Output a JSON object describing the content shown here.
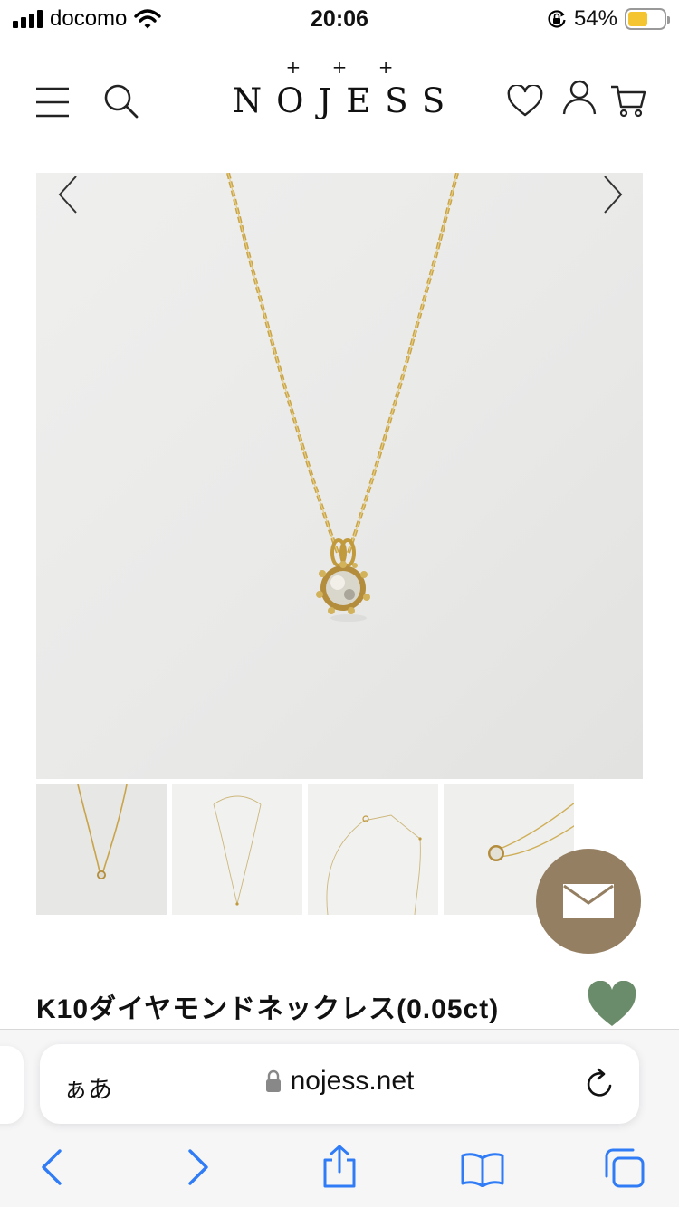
{
  "status_bar": {
    "carrier": "docomo",
    "time": "20:06",
    "battery_percent": "54%",
    "battery_level": 0.54,
    "icons": [
      "signal-icon",
      "wifi-icon",
      "orientation-lock-icon",
      "battery-icon"
    ]
  },
  "header": {
    "brand_ornament": "+ + +",
    "brand": "NOJESS",
    "icons": [
      "menu-icon",
      "search-icon",
      "heart-icon",
      "account-icon",
      "cart-icon"
    ]
  },
  "gallery": {
    "prev_icon": "chevron-left-icon",
    "next_icon": "chevron-right-icon",
    "thumbnails": [
      "thumbnail-1",
      "thumbnail-2",
      "thumbnail-3",
      "thumbnail-4"
    ]
  },
  "product": {
    "title": "K10ダイヤモンドネックレス(0.05ct)",
    "favorite_color": "#6b8c6a"
  },
  "contact": {
    "icon": "envelope-icon",
    "color": "#957f62"
  },
  "browser": {
    "text_size_label": "ぁあ",
    "url": "nojess.net",
    "icons": [
      "lock-icon",
      "reload-icon",
      "back-icon",
      "forward-icon",
      "share-icon",
      "bookmarks-icon",
      "tabs-icon"
    ],
    "accent": "#2f7cf6"
  }
}
